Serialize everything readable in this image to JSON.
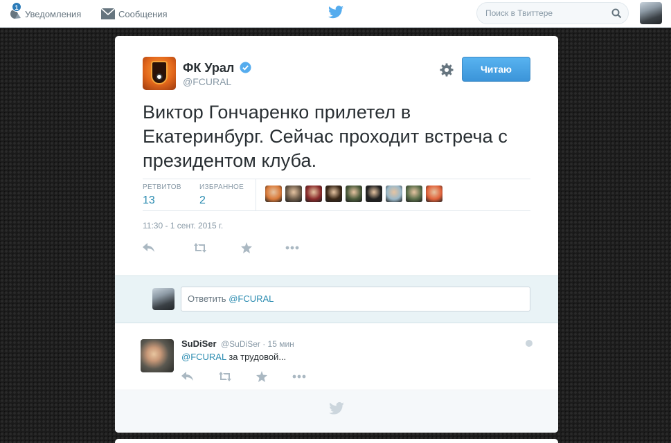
{
  "nav": {
    "notifications_label": "Уведомления",
    "notifications_count": "1",
    "messages_label": "Сообщения",
    "search_placeholder": "Поиск в Твиттере"
  },
  "tweet": {
    "author_name": "ФК Урал",
    "author_handle": "@FCURAL",
    "follow_label": "Читаю",
    "text": "Виктор Гончаренко прилетел в Екатеринбург. Сейчас проходит встреча с президентом клуба.",
    "retweets_label": "РЕТВИТОВ",
    "retweets_count": "13",
    "favorites_label": "ИЗБРАННОЕ",
    "favorites_count": "2",
    "timestamp": "11:30 - 1 сент. 2015 г.",
    "favoriter_avatars": [
      "#d97a3a",
      "#6b5a48",
      "#8a2b2b",
      "#3a2818",
      "#4a5a3a",
      "#222222",
      "#9ab8c8",
      "#5a6e4a",
      "#e0623a"
    ]
  },
  "reply_box": {
    "prefix": "Ответить ",
    "mention": "@FCURAL"
  },
  "replies": [
    {
      "name": "SuDiSer",
      "meta": "@SuDiSer · 15 мин",
      "mention": "@FCURAL",
      "text": " за трудовой..."
    }
  ],
  "colors": {
    "accent": "#55acee",
    "link": "#2a8bb0",
    "icon": "#aab8c2"
  }
}
